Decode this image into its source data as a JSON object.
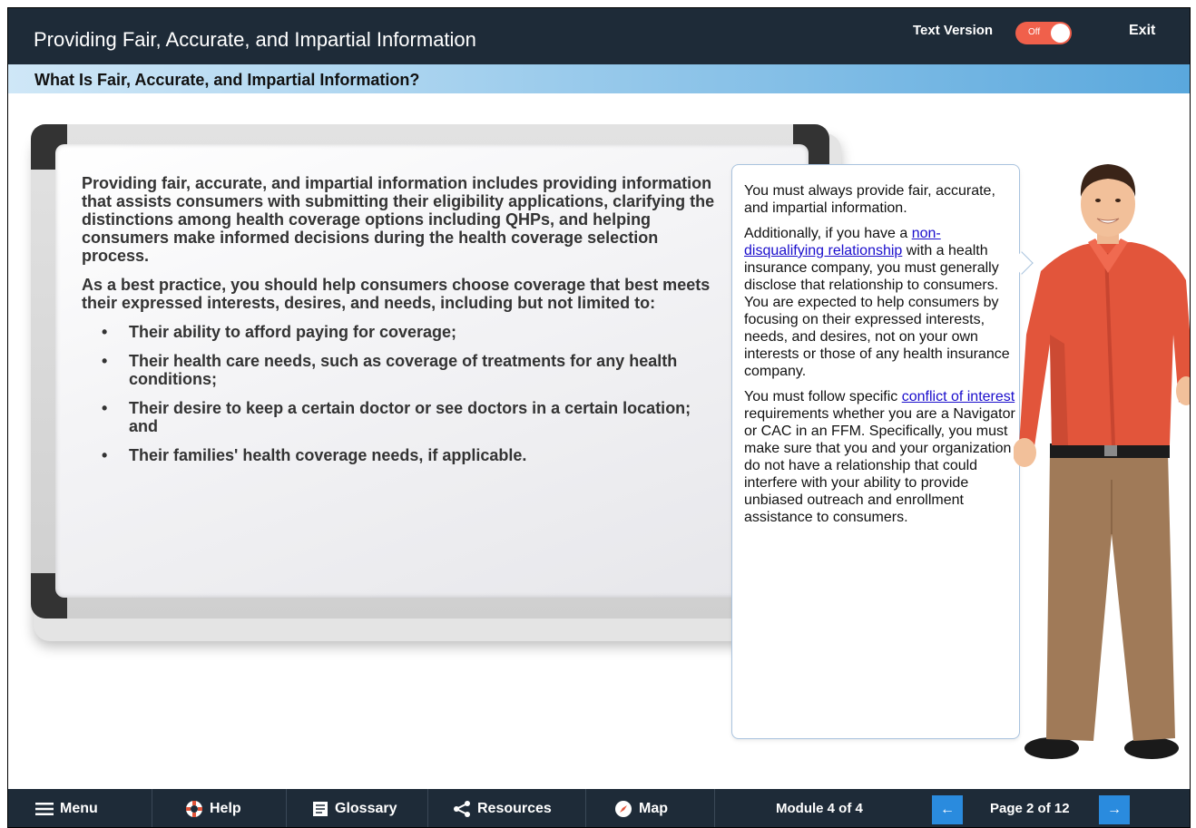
{
  "header": {
    "course_title": "Providing Fair, Accurate, and Impartial Information",
    "text_version_label": "Text Version",
    "toggle_state": "Off",
    "exit_label": "Exit"
  },
  "section": {
    "title": "What Is Fair, Accurate, and Impartial Information?"
  },
  "board": {
    "paragraph_1": "Providing fair, accurate, and impartial information includes providing information that assists consumers with submitting their eligibility applications, clarifying the distinctions among health coverage options including QHPs, and helping consumers make informed decisions during the health coverage selection process.",
    "paragraph_2": "As a best practice, you should help consumers choose coverage that best meets their expressed interests, desires, and needs, including but not limited to:",
    "bullets": [
      "Their ability to afford paying for coverage;",
      "Their health care needs, such as coverage of treatments for any health conditions;",
      "Their desire to keep a certain doctor or see doctors in a certain location; and",
      "Their families' health coverage needs, if applicable."
    ]
  },
  "bubble": {
    "p1": "You must always provide fair, accurate, and impartial information.",
    "p2_before": "Additionally, if you have a ",
    "p2_link": "non-disqualifying relationship",
    "p2_after": " with a health insurance company, you must generally disclose that relationship to consumers. You are expected to help consumers by focusing on their expressed interests, needs, and desires, not on your own interests or those of any health insurance company.",
    "p3_before": "You must follow specific ",
    "p3_link": "conflict of interest",
    "p3_after": " requirements whether you are a Navigator or CAC in an FFM. Specifically, you must make sure that you and your organization do not have a relationship that could interfere with your ability to provide unbiased outreach and enrollment assistance to consumers."
  },
  "footer": {
    "menu_label": "Menu",
    "help_label": "Help",
    "glossary_label": "Glossary",
    "resources_label": "Resources",
    "map_label": "Map",
    "module_label": "Module 4 of 4",
    "page_label": "Page 2 of 12",
    "prev_icon": "arrow-left-icon",
    "next_icon": "arrow-right-icon"
  },
  "colors": {
    "bar_dark": "#1e2b38",
    "toggle_off": "#f0604b",
    "accent_blue": "#2a8bde",
    "link": "#1a0dcc"
  }
}
